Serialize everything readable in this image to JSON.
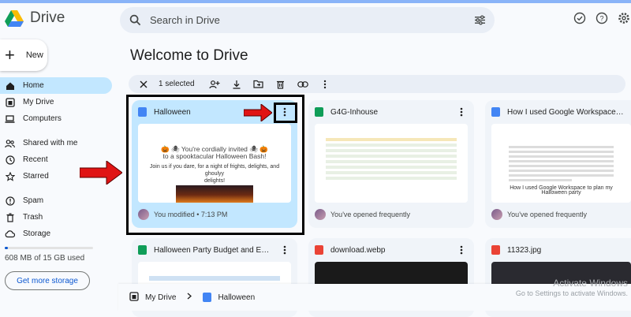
{
  "app": {
    "name": "Drive"
  },
  "search": {
    "placeholder": "Search in Drive"
  },
  "new_button": {
    "label": "New"
  },
  "nav": {
    "items": [
      {
        "label": "Home",
        "icon": "home-icon",
        "active": true
      },
      {
        "label": "My Drive",
        "icon": "my-drive-icon"
      },
      {
        "label": "Computers",
        "icon": "computers-icon"
      },
      {
        "label": "Shared with me",
        "icon": "shared-icon"
      },
      {
        "label": "Recent",
        "icon": "clock-icon"
      },
      {
        "label": "Starred",
        "icon": "star-icon"
      },
      {
        "label": "Spam",
        "icon": "spam-icon"
      },
      {
        "label": "Trash",
        "icon": "trash-icon"
      },
      {
        "label": "Storage",
        "icon": "cloud-icon"
      }
    ]
  },
  "storage": {
    "text": "608 MB of 15 GB used",
    "used_fraction": 0.04,
    "button": "Get more storage"
  },
  "main": {
    "title": "Welcome to Drive"
  },
  "toolbar": {
    "selected_text": "1 selected"
  },
  "files": [
    {
      "name": "Halloween",
      "type": "doc",
      "footer": "You modified • 7:13 PM",
      "selected": true
    },
    {
      "name": "G4G-Inhouse",
      "type": "sheet",
      "footer": "You've opened frequently"
    },
    {
      "name": "How I used Google Workspace to plan...",
      "type": "doc",
      "footer": "You've opened frequently"
    },
    {
      "name": "Halloween Party Budget and Expenses",
      "type": "sheet"
    },
    {
      "name": "download.webp",
      "type": "image"
    },
    {
      "name": "11323.jpg",
      "type": "image"
    }
  ],
  "invite": {
    "line1": "🎃 🕷 You're cordially invited 🕷 🎃",
    "line2": "to a spooktacular Halloween Bash!",
    "line3": "Join us if you dare, for a night of frights, delights, and ghoulyy",
    "line4": "delights!"
  },
  "workspace_doc": {
    "heading": "How I used Google Workspace to plan my Halloween party"
  },
  "breadcrumb": {
    "root": "My Drive",
    "current": "Halloween"
  },
  "watermark": {
    "line1": "Activate Windows",
    "line2": "Go to Settings to activate Windows."
  },
  "colors": {
    "accent": "#0b57d0",
    "selected": "#c2e7ff",
    "annotation_arrow": "#e01414"
  }
}
